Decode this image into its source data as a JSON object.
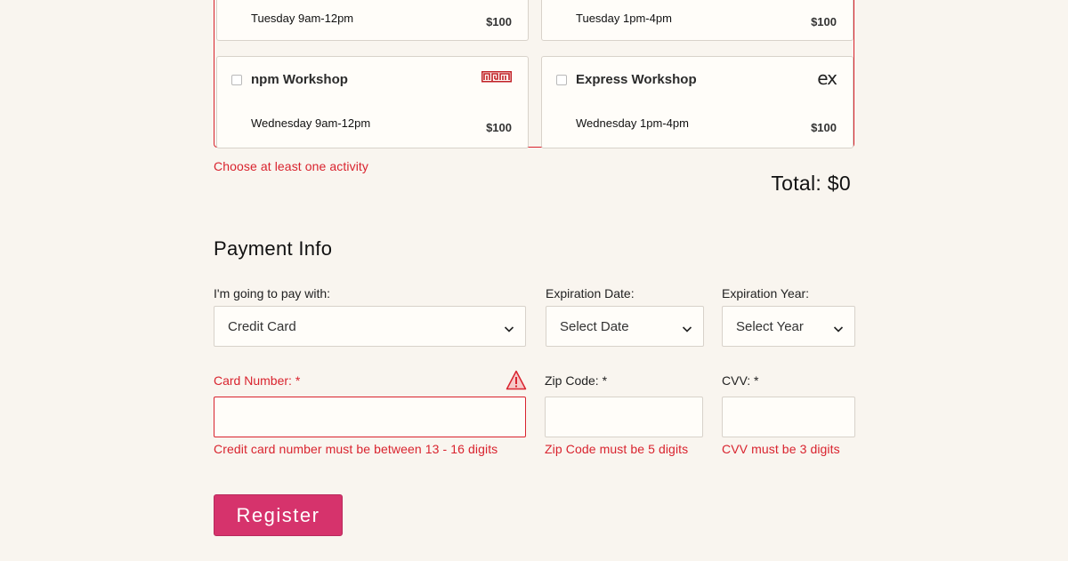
{
  "activities": [
    {
      "name": "",
      "time": "Tuesday 9am-12pm",
      "cost": "$100",
      "icon": "none"
    },
    {
      "name": "",
      "time": "Tuesday 1pm-4pm",
      "cost": "$100",
      "icon": "none"
    },
    {
      "name": "npm Workshop",
      "time": "Wednesday 9am-12pm",
      "cost": "$100",
      "icon": "npm-logo-icon"
    },
    {
      "name": "Express Workshop",
      "time": "Wednesday 1pm-4pm",
      "cost": "$100",
      "icon": "express-logo-icon"
    }
  ],
  "logos": {
    "npm": "npm",
    "express": "ex"
  },
  "activities_error": "Choose at least one activity",
  "total": "Total: $0",
  "payment": {
    "title": "Payment Info",
    "pay_with_label": "I'm going to pay with:",
    "pay_with_value": "Credit Card",
    "exp_date_label": "Expiration Date:",
    "exp_date_value": "Select Date",
    "exp_year_label": "Expiration Year:",
    "exp_year_value": "Select Year",
    "card_number_label": "Card Number:",
    "zip_label": "Zip Code:",
    "cvv_label": "CVV:",
    "required_mark": "*",
    "card_number_value": "",
    "zip_value": "",
    "cvv_value": "",
    "card_number_error": "Credit card number must be between 13 - 16 digits",
    "zip_error": "Zip Code must be 5 digits",
    "cvv_error": "CVV must be 3 digits"
  },
  "register_label": "Register",
  "colors": {
    "error": "#d9232e",
    "accent": "#d6336c",
    "background": "#f9f5ef"
  }
}
